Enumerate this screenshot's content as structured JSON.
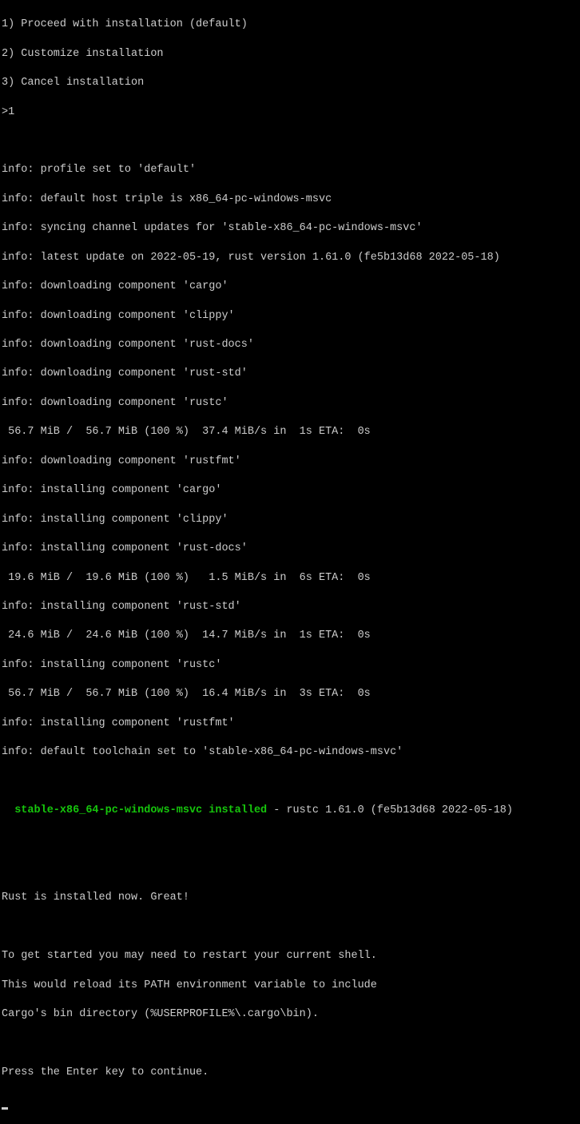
{
  "menu": {
    "opt1": "1) Proceed with installation (default)",
    "opt2": "2) Customize installation",
    "opt3": "3) Cancel installation",
    "prompt": ">1"
  },
  "info": {
    "profile": "info: profile set to 'default'",
    "host": "info: default host triple is x86_64-pc-windows-msvc",
    "sync": "info: syncing channel updates for 'stable-x86_64-pc-windows-msvc'",
    "latest": "info: latest update on 2022-05-19, rust version 1.61.0 (fe5b13d68 2022-05-18)",
    "dl_cargo": "info: downloading component 'cargo'",
    "dl_clippy": "info: downloading component 'clippy'",
    "dl_rustdocs": "info: downloading component 'rust-docs'",
    "dl_ruststd": "info: downloading component 'rust-std'",
    "dl_rustc": "info: downloading component 'rustc'",
    "progress1": " 56.7 MiB /  56.7 MiB (100 %)  37.4 MiB/s in  1s ETA:  0s",
    "dl_rustfmt": "info: downloading component 'rustfmt'",
    "inst_cargo": "info: installing component 'cargo'",
    "inst_clippy": "info: installing component 'clippy'",
    "inst_rustdocs": "info: installing component 'rust-docs'",
    "progress2": " 19.6 MiB /  19.6 MiB (100 %)   1.5 MiB/s in  6s ETA:  0s",
    "inst_ruststd": "info: installing component 'rust-std'",
    "progress3": " 24.6 MiB /  24.6 MiB (100 %)  14.7 MiB/s in  1s ETA:  0s",
    "inst_rustc": "info: installing component 'rustc'",
    "progress4": " 56.7 MiB /  56.7 MiB (100 %)  16.4 MiB/s in  3s ETA:  0s",
    "inst_rustfmt": "info: installing component 'rustfmt'",
    "toolchain": "info: default toolchain set to 'stable-x86_64-pc-windows-msvc'"
  },
  "success": {
    "indent": "  ",
    "installed_text": "stable-x86_64-pc-windows-msvc installed",
    "version_text": " - rustc 1.61.0 (fe5b13d68 2022-05-18)"
  },
  "outro": {
    "great": "Rust is installed now. Great!",
    "restart1": "To get started you may need to restart your current shell.",
    "restart2": "This would reload its PATH environment variable to include",
    "restart3": "Cargo's bin directory (%USERPROFILE%\\.cargo\\bin).",
    "press": "Press the Enter key to continue."
  }
}
